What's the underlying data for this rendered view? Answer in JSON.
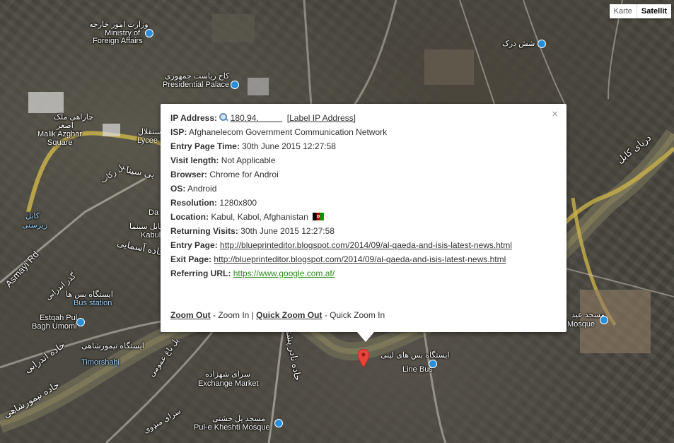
{
  "map": {
    "type_buttons": {
      "map": "Karte",
      "satellite": "Satellit"
    },
    "labels": {
      "ministry_fa": "وزارت امور خارجه",
      "ministry_en_1": "Ministry of",
      "ministry_en_2": "Foreign Affairs",
      "palace_fa": "کاخ ریاست جمهوری",
      "palace_en": "Presidential Palace",
      "shash_darak": "شش درک",
      "malik_fa": "چاراهی ملک",
      "malik_fa2": "اصغر",
      "malik_en_1": "Malik Azghar",
      "malik_en_2": "Square",
      "lycee_fa": "لیسه استقلال",
      "lycee_en": "Lycee E",
      "kabul_river": "دریای کابل",
      "asmayi_rd": "Asmayi Rd",
      "da": "Da",
      "kabul": "Kabul",
      "station_fa": "ایستگاه بس ها",
      "station_en": "Bus station",
      "estqah_1": "Estqah Pul",
      "estqah_2": "Bagh Umomi",
      "timor_fa": "ایستگاه تیمورشاهی",
      "timor_en": "Timorshahi",
      "exchange_fa": "سرای شهزاده",
      "exchange_en": "Exchange Market",
      "pul_fa": "مسجد پل خشتی",
      "pul_en": "Pul-e Kheshti Mosque",
      "line_fa": "ایستگاه بس های لینی",
      "line_en": "Line Bus",
      "mosque_fa": "مسجد عید",
      "mosque_en": "Mosque",
      "nader_pashtun": "جاده نادر پشتون",
      "timor_rd": "جاده تیمورشاهی",
      "andarabi": "جاده اندرابی",
      "bagh_umomi_rd": "پل باغ عمومی",
      "sara": "سرای منډوی",
      "road_top": "بی سینا",
      "asmayi_fa": "جاده آسمایی",
      "kabul_fa": "کابل",
      "rikab": "پل رکاب",
      "kabul_fa2": "کابل سینما",
      "ez": "زیرستی",
      "shorba": "گذر اندرابی"
    }
  },
  "popup": {
    "ip_label": "IP Address:",
    "ip_value": "180.94.",
    "ip_link": "[Label IP Address]",
    "isp_label": "ISP:",
    "isp_value": "Afghanelecom Government Communication Network",
    "entry_time_label": "Entry Page Time:",
    "entry_time_value": "30th June 2015 12:27:58",
    "visit_length_label": "Visit length:",
    "visit_length_value": "Not Applicable",
    "browser_label": "Browser:",
    "browser_value": "Chrome for Androi",
    "os_label": "OS:",
    "os_value": "Android",
    "resolution_label": "Resolution:",
    "resolution_value": "1280x800",
    "location_label": "Location:",
    "location_value": "Kabul, Kabol, Afghanistan",
    "returning_label": "Returning Visits:",
    "returning_value": "30th June 2015 12:27:58",
    "entry_page_label": "Entry Page:",
    "entry_page_value": "http://blueprinteditor.blogspot.com/2014/09/al-qaeda-and-isis-latest-news.html",
    "exit_page_label": "Exit Page:",
    "exit_page_value": "http://blueprinteditor.blogspot.com/2014/09/al-qaeda-and-isis-latest-news.html",
    "referring_label": "Referring URL:",
    "referring_value": "https://www.google.com.af/",
    "zoom_out": "Zoom Out",
    "zoom_in": " - Zoom In | ",
    "quick_zoom_out": "Quick Zoom Out",
    "quick_zoom_in": " - Quick Zoom In",
    "close": "×"
  }
}
